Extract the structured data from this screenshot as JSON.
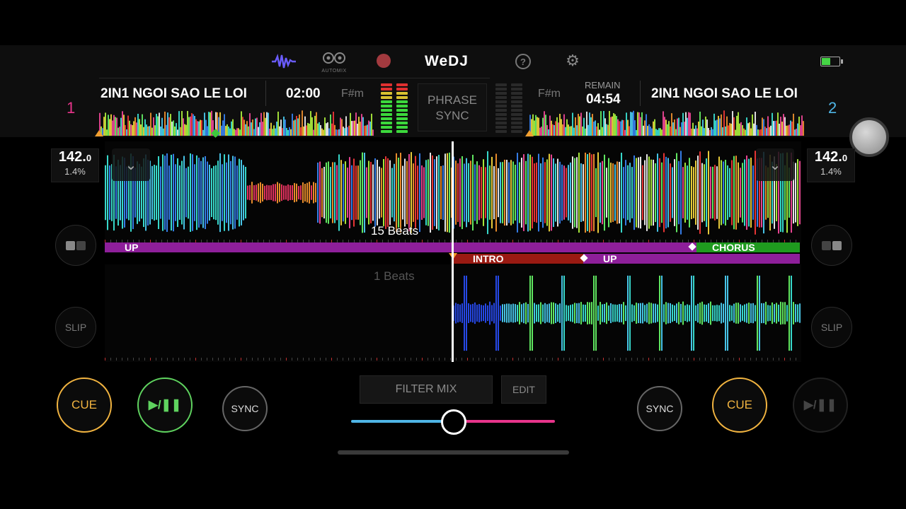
{
  "header": {
    "logo": "WeDJ",
    "automix_label": "AUTOMIX",
    "phrase_sync_line1": "PHRASE",
    "phrase_sync_line2": "SYNC",
    "icons": [
      "waveform-icon",
      "automix-icon",
      "record-icon",
      "help-icon",
      "settings-icon",
      "battery-icon"
    ]
  },
  "deck1": {
    "number": "1",
    "title": "2IN1 NGOI SAO LE LOI",
    "time": "02:00",
    "key": "F#m",
    "bpm_main": "142.",
    "bpm_decimal": "0",
    "pitch": "1.4%",
    "beats_label": "15 Beats",
    "phrase_label": "UP",
    "cue": "CUE",
    "play": "▶/❚❚",
    "sync": "SYNC",
    "slip": "SLIP",
    "color": "#e8348b"
  },
  "deck2": {
    "number": "2",
    "title": "2IN1 NGOI SAO LE LOI",
    "remain_label": "REMAIN",
    "remain_time": "04:54",
    "key": "F#m",
    "bpm_main": "142.",
    "bpm_decimal": "0",
    "pitch": "1.4%",
    "beats_label": "1 Beats",
    "phrase_intro": "INTRO",
    "phrase_up": "UP",
    "phrase_chorus": "CHORUS",
    "cue": "CUE",
    "play": "▶/❚❚",
    "sync": "SYNC",
    "slip": "SLIP",
    "color": "#4fb5e6"
  },
  "mixer": {
    "filter_mix": "FILTER MIX",
    "edit": "EDIT",
    "crossfader_position": 0.5
  },
  "colors": {
    "deck1_accent": "#e8348b",
    "deck2_accent": "#4fb5e6",
    "cue_ring": "#f2b440",
    "play_ring": "#5fd35f",
    "phrase_up": "#8e1f9a",
    "phrase_intro": "#9a1a12",
    "phrase_chorus": "#1f9a1f"
  }
}
